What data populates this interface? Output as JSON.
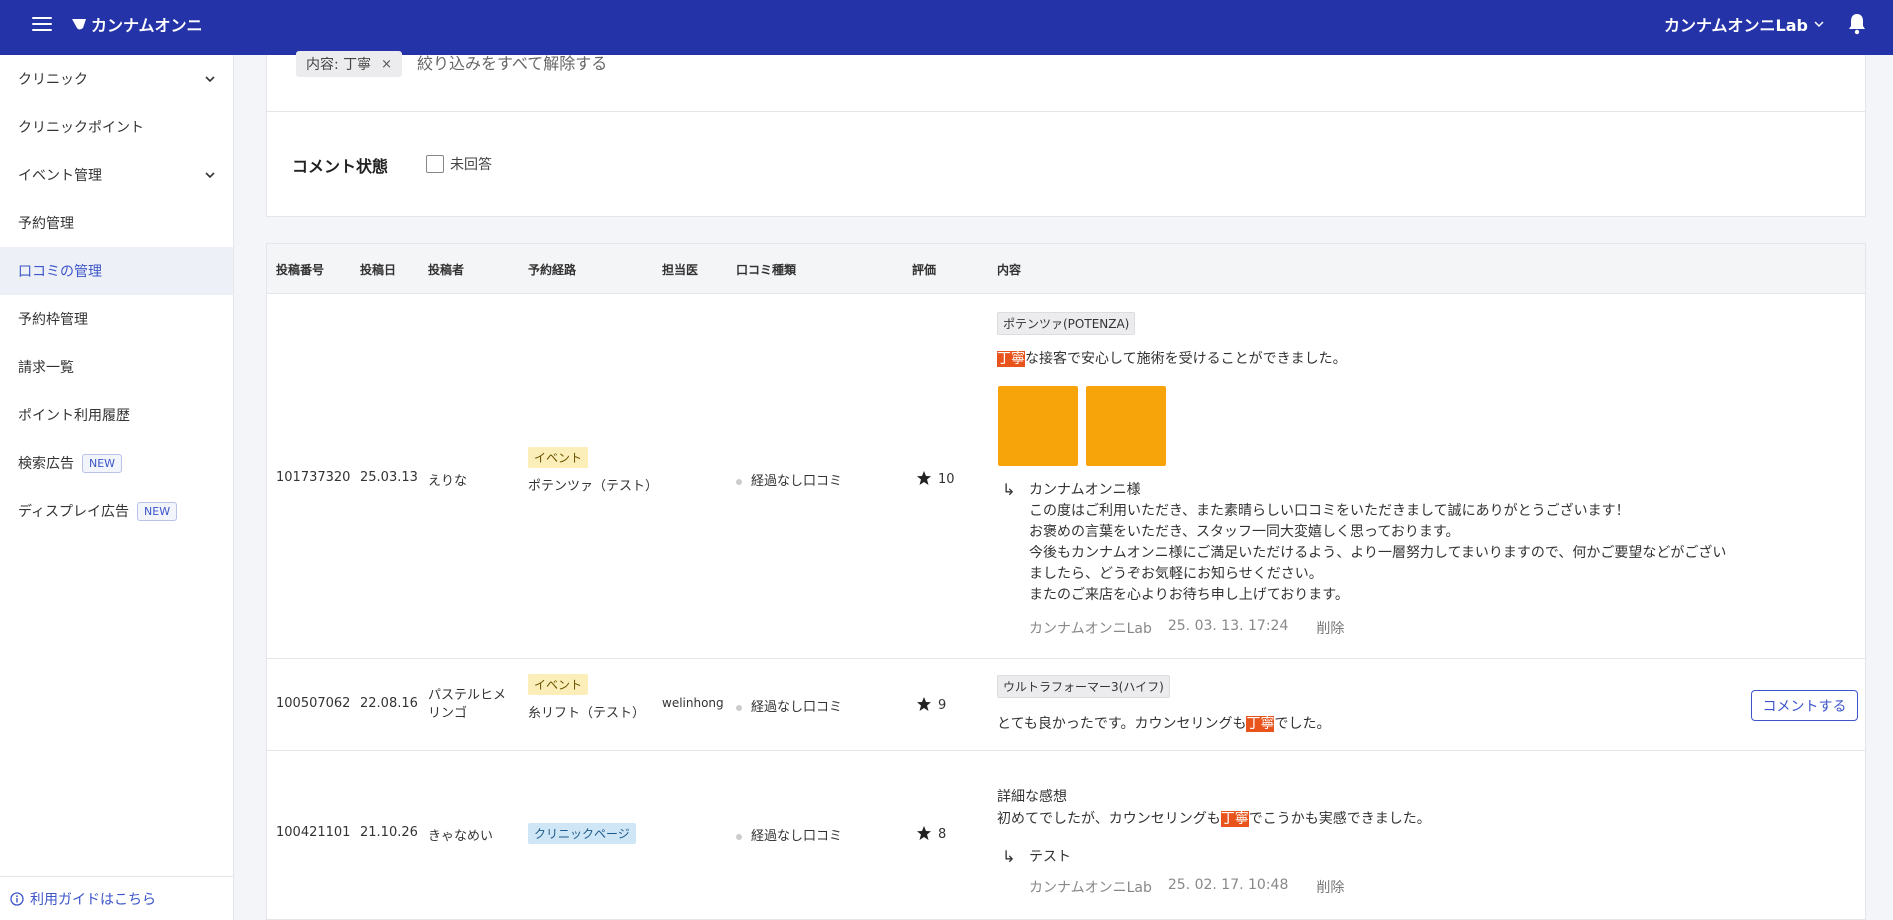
{
  "header": {
    "brand": "カンナムオンニ",
    "account": "カンナムオンニLab"
  },
  "sidebar": {
    "items": [
      {
        "label": "クリニック",
        "expandable": true
      },
      {
        "label": "クリニックポイント"
      },
      {
        "label": "イベント管理",
        "expandable": true
      },
      {
        "label": "予約管理"
      },
      {
        "label": "口コミの管理",
        "active": true
      },
      {
        "label": "予約枠管理"
      },
      {
        "label": "請求一覧"
      },
      {
        "label": "ポイント利用履歴"
      },
      {
        "label": "検索広告",
        "badge": "NEW"
      },
      {
        "label": "ディスプレイ広告",
        "badge": "NEW"
      }
    ],
    "guide": "利用ガイドはこちら"
  },
  "filter": {
    "chip_label": "内容: 丁寧",
    "chip_remove": "×",
    "clear_all": "絞り込みをすべて解除する",
    "comment_state_label": "コメント状態",
    "unanswered_label": "未回答"
  },
  "table": {
    "columns": [
      "投稿番号",
      "投稿日",
      "投稿者",
      "予約経路",
      "担当医",
      "口コミ種類",
      "評価",
      "内容"
    ],
    "rows": [
      {
        "id": "101737320",
        "date": "25.03.13",
        "author": "えりな",
        "route_tag": "イベント",
        "route_name": "ポテンツァ（テスト）",
        "doctor": "",
        "review_type": "経過なし口コミ",
        "rating": "10",
        "treatment": "ポテンツァ(POTENZA)",
        "content_hl": "丁寧",
        "content_rest": "な接客で安心して施術を受けることができました。",
        "reply": {
          "greeting": "カンナムオンニ様",
          "lines": [
            "この度はご利用いただき、また素晴らしい口コミをいただきまして誠にありがとうございます！",
            "お褒めの言葉をいただき、スタッフ一同大変嬉しく思っております。",
            "今後もカンナムオンニ様にご満足いただけるよう、より一層努力してまいりますので、何かご要望などがござい",
            "ましたら、どうぞお気軽にお知らせください。",
            "またのご来店を心よりお待ち申し上げております。"
          ],
          "author": "カンナムオンニLab",
          "time": "25. 03. 13. 17:24",
          "delete": "削除"
        }
      },
      {
        "id": "100507062",
        "date": "22.08.16",
        "author_line1": "パステルヒメ",
        "author_line2": "リンゴ",
        "route_tag": "イベント",
        "route_name": "糸リフト（テスト）",
        "doctor": "welinhong",
        "review_type": "経過なし口コミ",
        "rating": "9",
        "treatment": "ウルトラフォーマー3(ハイフ)",
        "content_pre": "とても良かったです。カウンセリングも",
        "content_hl": "丁寧",
        "content_post": "でした。",
        "comment_button": "コメントする"
      },
      {
        "id": "100421101",
        "date": "21.10.26",
        "author": "きゃなめい",
        "route_tag": "クリニックページ",
        "doctor": "",
        "review_type": "経過なし口コミ",
        "rating": "8",
        "content_title": "詳細な感想",
        "content_pre": "初めてでしたが、カウンセリングも",
        "content_hl": "丁寧",
        "content_post": "でこうかも実感できました。",
        "reply": {
          "text": "テスト",
          "author": "カンナムオンニLab",
          "time": "25. 02. 17. 10:48",
          "delete": "削除"
        }
      }
    ]
  }
}
